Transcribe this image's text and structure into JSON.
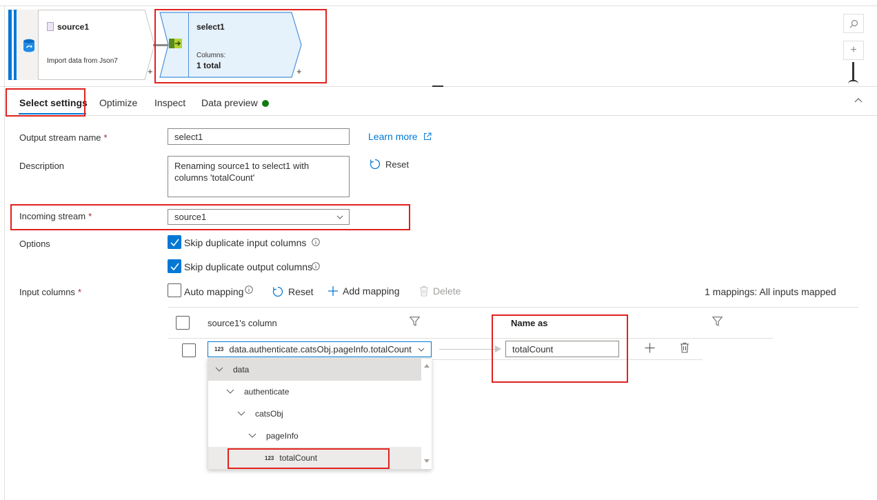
{
  "canvas": {
    "source_node": {
      "title": "source1",
      "subtitle": "Import data from Json7",
      "plus": "+",
      "icon": "database-icon"
    },
    "select_node": {
      "title": "select1",
      "columns_label": "Columns:",
      "columns_value": "1 total",
      "plus": "+",
      "icon": "select-transform-icon"
    },
    "zoom": {
      "search_icon": "search-icon",
      "zoom_in": "+"
    }
  },
  "tabs": [
    {
      "label": "Select settings",
      "active": true
    },
    {
      "label": "Optimize",
      "active": false
    },
    {
      "label": "Inspect",
      "active": false
    },
    {
      "label": "Data preview",
      "active": false,
      "status_color": "#107c10"
    }
  ],
  "form": {
    "output_stream": {
      "label": "Output stream name",
      "required": "*",
      "value": "select1"
    },
    "learn_more": "Learn more",
    "description": {
      "label": "Description",
      "value": "Renaming source1 to select1 with columns 'totalCount'"
    },
    "reset_label": "Reset",
    "incoming_stream": {
      "label": "Incoming stream",
      "required": "*",
      "value": "source1"
    },
    "options": {
      "label": "Options",
      "skip_input": "Skip duplicate input columns",
      "skip_output": "Skip duplicate output columns"
    },
    "input_columns": {
      "label": "Input columns",
      "required": "*",
      "auto_mapping": "Auto mapping",
      "reset": "Reset",
      "add_mapping": "Add mapping",
      "delete": "Delete",
      "status": "1 mappings: All inputs mapped"
    }
  },
  "grid": {
    "col_source": "source1's column",
    "col_name_as": "Name as",
    "row": {
      "type_badge": "123",
      "source_value": "data.authenticate.catsObj.pageInfo.totalCount",
      "name_as_value": "totalCount"
    }
  },
  "dropdown": {
    "items": [
      {
        "label": "data",
        "level": 0
      },
      {
        "label": "authenticate",
        "level": 1
      },
      {
        "label": "catsObj",
        "level": 2
      },
      {
        "label": "pageInfo",
        "level": 3
      },
      {
        "label": "totalCount",
        "level": 4,
        "type_badge": "123"
      }
    ]
  },
  "colors": {
    "accent": "#0078d4",
    "highlight": "#e0201c",
    "ok": "#107c10",
    "required": "#a4262c"
  }
}
